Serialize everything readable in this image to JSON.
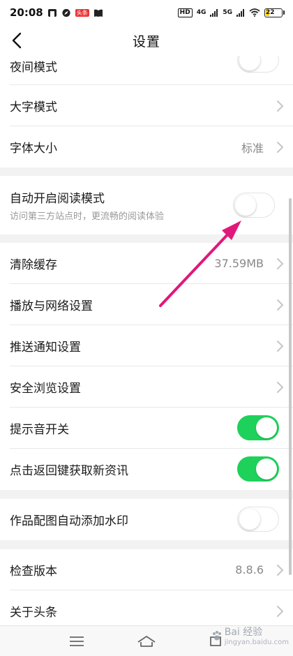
{
  "status_bar": {
    "time": "20:08",
    "badge": "头条",
    "hd": "HD",
    "net1": "4G",
    "net2": "5G",
    "battery": "22"
  },
  "header": {
    "title": "设置"
  },
  "settings": {
    "night_mode": {
      "label": "夜间模式",
      "on": false
    },
    "large_font_mode": {
      "label": "大字模式"
    },
    "font_size": {
      "label": "字体大小",
      "value": "标准"
    },
    "auto_reading_mode": {
      "label": "自动开启阅读模式",
      "description": "访问第三方站点时，更流畅的阅读体验",
      "on": false
    },
    "clear_cache": {
      "label": "清除缓存",
      "value": "37.59MB"
    },
    "playback_network": {
      "label": "播放与网络设置"
    },
    "push_notifications": {
      "label": "推送通知设置"
    },
    "safe_browsing": {
      "label": "安全浏览设置"
    },
    "sound_switch": {
      "label": "提示音开关",
      "on": true
    },
    "back_key_refresh": {
      "label": "点击返回键获取新资讯",
      "on": true
    },
    "watermark_toggle": {
      "label": "作品配图自动添加水印",
      "on": false
    },
    "check_version": {
      "label": "检查版本",
      "value": "8.8.6"
    },
    "about": {
      "label": "关于头条"
    }
  },
  "watermark": {
    "text": "Bai 经验",
    "sub": "jingyan.baidu.com"
  },
  "colors": {
    "toggle_on": "#1ed15b",
    "annotation_arrow": "#e0187a",
    "section_gap": "#f2f2f2"
  }
}
